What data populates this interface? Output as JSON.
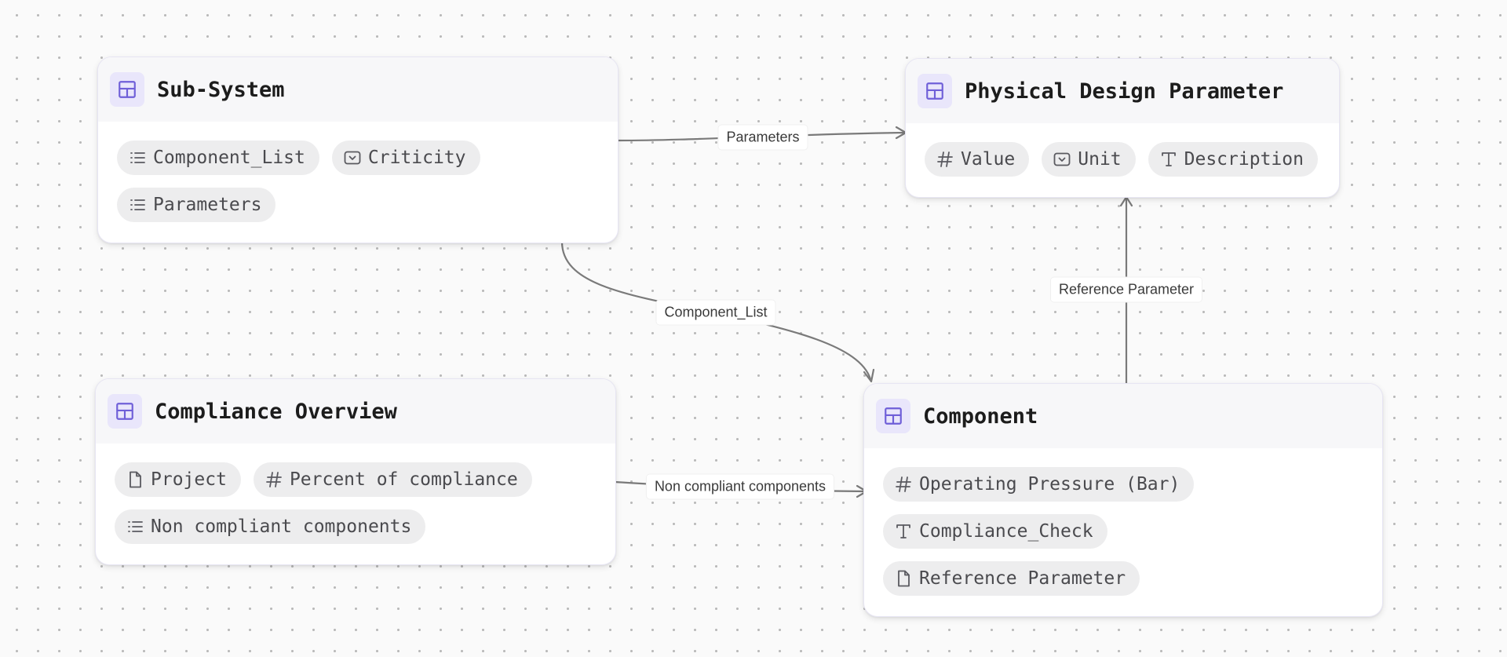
{
  "colors": {
    "canvas_background": "#fafafa",
    "dot_grid": "#b9b9b9",
    "node_header": "#f7f7f9",
    "icon_tile": "#e9e6fb",
    "icon_accent": "#6f5fd8",
    "chip_background": "#ededee",
    "edge": "#7a7a7a"
  },
  "nodes": {
    "sub_system": {
      "title": "Sub-System",
      "icon": "table-icon",
      "fields": [
        {
          "label": "Component_List",
          "icon": "list-icon"
        },
        {
          "label": "Criticity",
          "icon": "select-icon"
        },
        {
          "label": "Parameters",
          "icon": "list-icon"
        }
      ]
    },
    "physical_design_parameter": {
      "title": "Physical Design Parameter",
      "icon": "table-icon",
      "fields": [
        {
          "label": "Value",
          "icon": "hash-icon"
        },
        {
          "label": "Unit",
          "icon": "select-icon"
        },
        {
          "label": "Description",
          "icon": "text-icon"
        }
      ]
    },
    "compliance_overview": {
      "title": "Compliance Overview",
      "icon": "table-icon",
      "fields": [
        {
          "label": "Project",
          "icon": "document-icon"
        },
        {
          "label": "Percent of compliance",
          "icon": "hash-icon"
        },
        {
          "label": "Non compliant components",
          "icon": "list-icon"
        }
      ]
    },
    "component": {
      "title": "Component",
      "icon": "table-icon",
      "fields": [
        {
          "label": "Operating Pressure (Bar)",
          "icon": "hash-icon"
        },
        {
          "label": "Compliance_Check",
          "icon": "text-icon"
        },
        {
          "label": "Reference Parameter",
          "icon": "document-icon"
        }
      ]
    }
  },
  "edges": [
    {
      "label": "Parameters",
      "from": "Sub-System",
      "to": "Physical Design Parameter"
    },
    {
      "label": "Component_List",
      "from": "Sub-System",
      "to": "Component"
    },
    {
      "label": "Reference Parameter",
      "from": "Component",
      "to": "Physical Design Parameter"
    },
    {
      "label": "Non compliant components",
      "from": "Compliance Overview",
      "to": "Component"
    }
  ]
}
